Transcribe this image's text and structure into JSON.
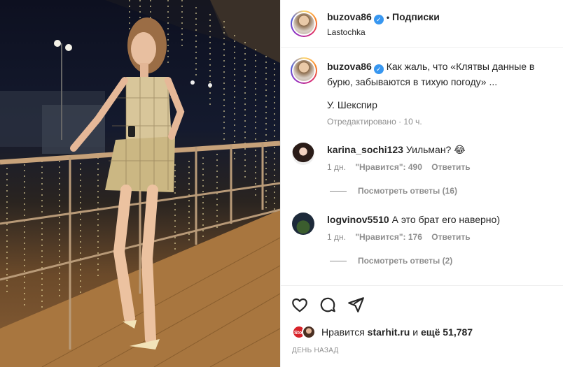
{
  "header": {
    "username": "buzova86",
    "verified_symbol": "✓",
    "separator": "•",
    "follow_label": "Подписки",
    "location": "Lastochka"
  },
  "caption": {
    "username": "buzova86",
    "text": "Как жаль, что «Клятвы данные в бурю, забываются в тихую погоду» ...",
    "author": "У. Шекспир",
    "edited": "Отредактировано",
    "time": "10 ч."
  },
  "comments": [
    {
      "username": "karina_sochi123",
      "text": "Уильман? 😂",
      "time": "1 дн.",
      "likes": "\"Нравится\": 490",
      "reply": "Ответить",
      "view_replies": "Посмотреть ответы (16)"
    },
    {
      "username": "logvinov5510",
      "text": "А это брат его наверно)",
      "time": "1 дн.",
      "likes": "\"Нравится\": 176",
      "reply": "Ответить",
      "view_replies": "Посмотреть ответы (2)"
    }
  ],
  "footer": {
    "liked_prefix": "Нравится",
    "liked_by": "starhit.ru",
    "liked_and": "и",
    "liked_others": "ещё 51,787",
    "liker_badge": "Stor",
    "date": "ДЕНЬ НАЗАД"
  },
  "icons": [
    "heart-icon",
    "comment-icon",
    "share-icon",
    "verified-badge-icon"
  ],
  "colors": {
    "verified": "#3897f0",
    "muted": "#8e8e8e",
    "text": "#262626",
    "divider": "#efefef"
  }
}
